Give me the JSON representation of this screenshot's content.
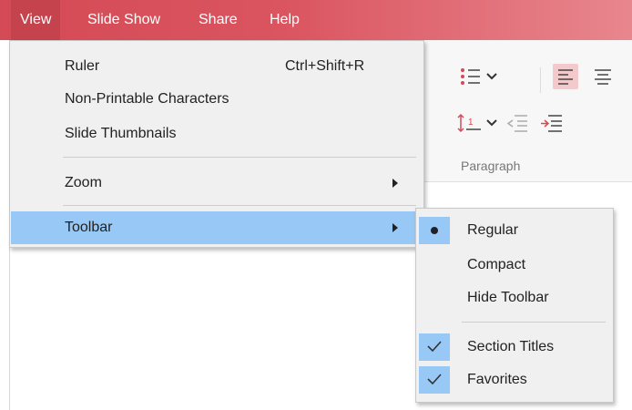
{
  "menubar": {
    "items": [
      {
        "label": "View"
      },
      {
        "label": "Slide Show"
      },
      {
        "label": "Share"
      },
      {
        "label": "Help"
      }
    ]
  },
  "ribbon": {
    "group_label": "Paragraph",
    "icons": [
      "bullet-list-icon",
      "chevron-down-icon",
      "align-left-icon",
      "align-center-icon",
      "line-spacing-icon",
      "chevron-down-icon",
      "decrease-indent-icon",
      "increase-indent-icon"
    ]
  },
  "view_menu": {
    "items": [
      {
        "label": "Ruler",
        "shortcut": "Ctrl+Shift+R"
      },
      {
        "label": "Non-Printable Characters"
      },
      {
        "label": "Slide Thumbnails"
      },
      {
        "label": "Zoom"
      },
      {
        "label": "Toolbar"
      }
    ]
  },
  "toolbar_submenu": {
    "items": [
      {
        "label": "Regular",
        "mark": "radio",
        "selected": true
      },
      {
        "label": "Compact"
      },
      {
        "label": "Hide Toolbar"
      },
      {
        "label": "Section Titles",
        "mark": "check",
        "checked": true
      },
      {
        "label": "Favorites",
        "mark": "check",
        "checked": true
      }
    ]
  },
  "colors": {
    "menubar": "#d44a55",
    "menu_highlight": "#98c8f5",
    "menu_bg": "#f0f0f0"
  }
}
